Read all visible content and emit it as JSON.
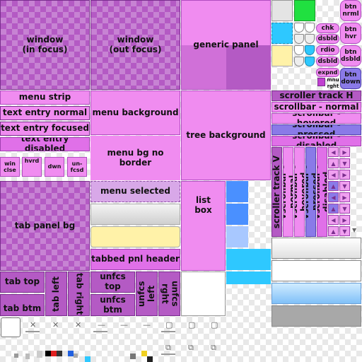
{
  "panels": {
    "window_focus": "window\n(in focus)",
    "window_unfocus": "window\n(out focus)",
    "generic_panel": "generic panel",
    "menu_strip": "menu strip",
    "menu_background": "menu background",
    "tree_background": "tree background",
    "menu_bg_no_border": "menu bg no border",
    "menu_selected": "menu selected",
    "list_box": "list\nbox",
    "tab_panel_bg": "tab panel bg",
    "tabbed_pnl_header": "tabbed pnl header"
  },
  "text_entry": {
    "normal": "text entry normal",
    "focused": "text entry focused",
    "disabled": "text entry disabled"
  },
  "window_buttons": {
    "close": "win\nclse",
    "hovered": "hvrd",
    "down": "dwn",
    "unfocused": "un-\nfcsd"
  },
  "small_buttons": {
    "chk": "chk",
    "disabled": "dsbld",
    "radio": "rdio",
    "radio_disabled": "dsbld",
    "expand": "expnd",
    "menu_right": "mnu\nrght"
  },
  "buttons": {
    "normal": "btn\nnrml",
    "hover": "btn\nhvr",
    "disabled": "btn\ndsbld",
    "down": "btn\ndown"
  },
  "scrollbars": {
    "track_h": "scroller track H",
    "normal": "scrollbar - normal",
    "hovered": "scrollbar - hovered",
    "pressed": "scrollbar - pressed",
    "disabled": "scrollbar - disabled",
    "track_v": "scroller track V",
    "v_normal": "vscrollbar - normal",
    "v_hovered": "vscrollbar - hovered",
    "v_pressed": "vscrollbar - pressed",
    "v_disabled": "vscrollbar - disabled"
  },
  "tabs": {
    "top": "tab top",
    "bottom": "tab btm",
    "left": "tab left",
    "right": "tab right",
    "unfocused_top": "unfcs top",
    "unfocused_bottom": "unfcs btm",
    "unfocused_left": "unfcs left",
    "unfocused_right": "unfcs rght"
  },
  "colors": {
    "purple_light": "#f08cf0",
    "purple_dark": "#b45ac4",
    "blue": "#4a90ff",
    "cyan": "#2ec8ff",
    "green": "#20e040",
    "yellow": "#fff2a8",
    "light_blue": "#a8d8ff"
  }
}
